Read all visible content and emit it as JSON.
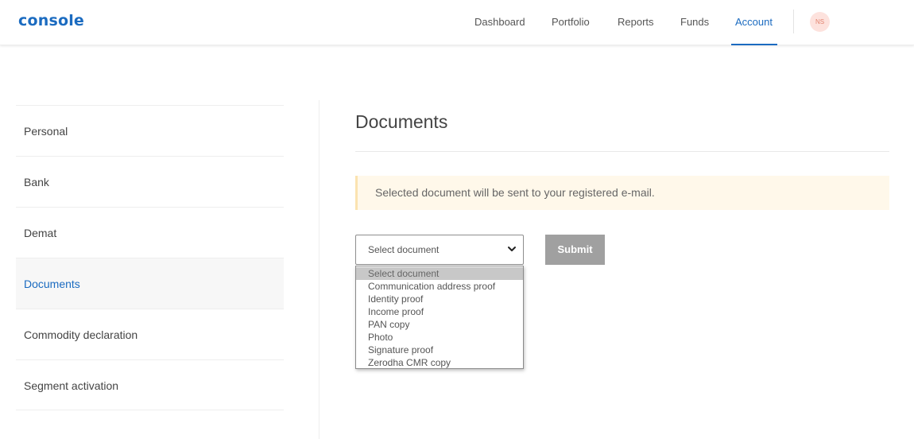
{
  "app": {
    "logo": "console"
  },
  "nav": {
    "items": [
      {
        "label": "Dashboard"
      },
      {
        "label": "Portfolio"
      },
      {
        "label": "Reports"
      },
      {
        "label": "Funds"
      },
      {
        "label": "Account"
      }
    ],
    "active": "Account",
    "avatar_initials": "NS"
  },
  "sidebar": {
    "items": [
      {
        "label": "Personal"
      },
      {
        "label": "Bank"
      },
      {
        "label": "Demat"
      },
      {
        "label": "Documents"
      },
      {
        "label": "Commodity declaration"
      },
      {
        "label": "Segment activation"
      }
    ],
    "active": "Documents"
  },
  "main": {
    "title": "Documents",
    "notice": "Selected document will be sent to your registered e-mail.",
    "select": {
      "value": "Select document",
      "options": [
        "Select document",
        "Communication address proof",
        "Identity proof",
        "Income proof",
        "PAN copy",
        "Photo",
        "Signature proof",
        "Zerodha CMR copy"
      ]
    },
    "submit_label": "Submit"
  },
  "colors": {
    "accent": "#1b6bc0",
    "notice_bg": "#fff8ea",
    "submit_bg": "#a0a0a0",
    "avatar_bg": "#fde2dd"
  },
  "icons": {
    "select_arrow": "chevron-down-icon"
  }
}
